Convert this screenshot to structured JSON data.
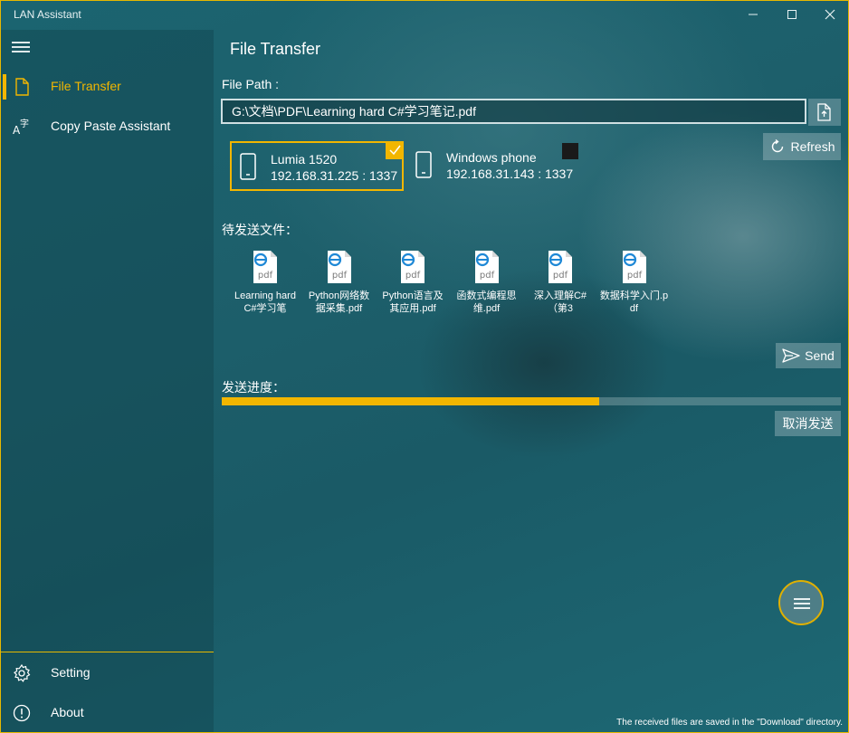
{
  "window": {
    "title": "LAN Assistant",
    "controls": {
      "minimize": "—",
      "maximize": "☐",
      "close": "✕"
    }
  },
  "sidebar": {
    "items": [
      {
        "label": "File Transfer",
        "icon": "file-icon",
        "active": true
      },
      {
        "label": "Copy Paste Assistant",
        "icon": "translate-icon",
        "active": false
      }
    ],
    "bottom_items": [
      {
        "label": "Setting",
        "icon": "gear-icon"
      },
      {
        "label": "About",
        "icon": "info-icon"
      }
    ]
  },
  "main": {
    "title": "File Transfer",
    "file_path_label": "File Path :",
    "file_path_value": "G:\\文档\\PDF\\Learning hard C#学习笔记.pdf",
    "refresh_label": "Refresh",
    "devices": [
      {
        "name": "Lumia 1520",
        "address": "192.168.31.225 : 1337",
        "selected": true
      },
      {
        "name": "Windows phone",
        "address": "192.168.31.143 : 1337",
        "selected": false
      }
    ],
    "pending_label": "待发送文件：",
    "files": [
      {
        "name": "Learning hard C#学习笔",
        "icon_text": "pdf"
      },
      {
        "name": "Python网络数据采集.pdf",
        "icon_text": "pdf"
      },
      {
        "name": "Python语言及其应用.pdf",
        "icon_text": "pdf"
      },
      {
        "name": "函数式编程思维.pdf",
        "icon_text": "pdf"
      },
      {
        "name": "深入理解C#（第3",
        "icon_text": "pdf"
      },
      {
        "name": "数据科学入门.pdf",
        "icon_text": "pdf"
      }
    ],
    "send_label": "Send",
    "progress_label": "发送进度：",
    "progress": 0.61,
    "cancel_label": "取消发送"
  },
  "footer": {
    "note": "The received files are saved in the \"Download\" directory."
  },
  "colors": {
    "accent": "#f2b600",
    "background": "#1d5f6b"
  }
}
